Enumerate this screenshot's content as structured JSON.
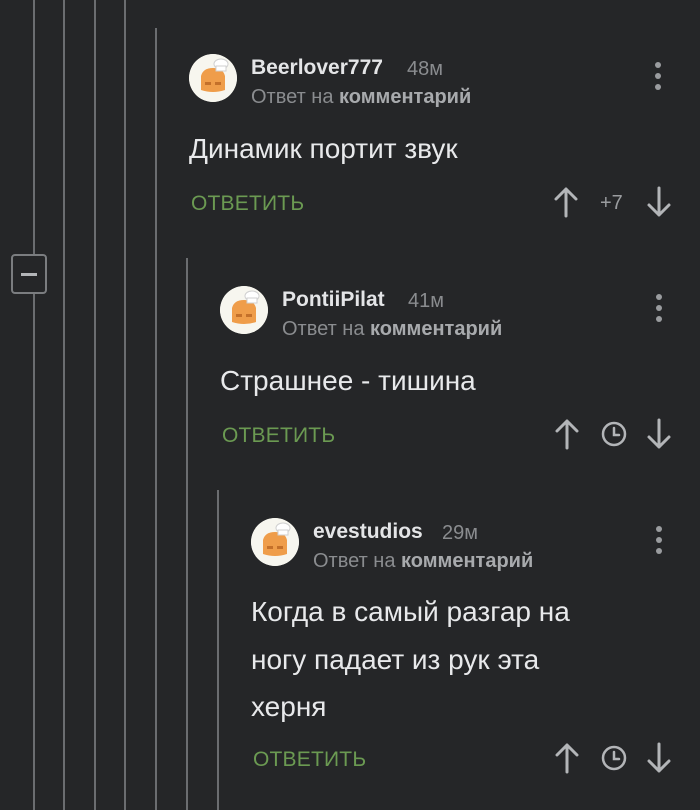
{
  "reply_label": "ОТВЕТИТЬ",
  "reply_to_prefix": "Ответ на",
  "reply_to_link": "комментарий",
  "comments": [
    {
      "author": "Beerlover777",
      "time": "48м",
      "text": "Динамик портит звук",
      "score": "+7"
    },
    {
      "author": "PontiiPilat",
      "time": "41м",
      "text": "Страшнее - тишина"
    },
    {
      "author": "evestudios",
      "time": "29м",
      "text_lines": [
        "Когда в самый разгар на",
        "ногу падает из рук эта",
        "херня"
      ]
    }
  ],
  "colors": {
    "background": "#252628",
    "reply_link": "#6b9a52",
    "thread_line": "#6b6d70"
  },
  "icons": [
    "collapse-icon",
    "avatar-chef-icon",
    "more-options-icon",
    "upvote-arrow-icon",
    "downvote-arrow-icon",
    "clock-icon"
  ]
}
